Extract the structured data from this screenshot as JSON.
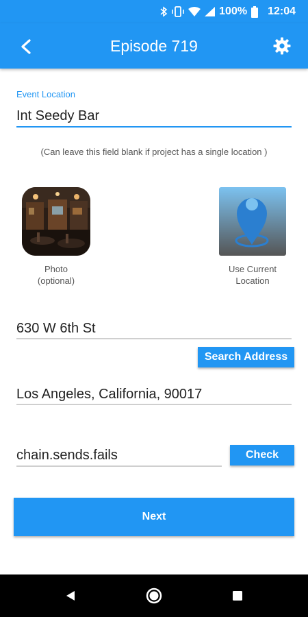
{
  "status_bar": {
    "battery_percent": "100%",
    "time": "12:04"
  },
  "app_bar": {
    "title": "Episode 719"
  },
  "event_location": {
    "label": "Event Location",
    "value": "Int Seedy Bar",
    "hint": "(Can leave this field blank if project has a single location )"
  },
  "photo": {
    "caption_line1": "Photo",
    "caption_line2": "(optional)"
  },
  "use_location": {
    "caption_line1": "Use Current",
    "caption_line2": "Location"
  },
  "address": {
    "street": "630 W 6th St",
    "search_button": "Search Address",
    "city": "Los Angeles, California, 90017"
  },
  "words": {
    "value": "chain.sends.fails",
    "check_button": "Check"
  },
  "next_button": "Next",
  "colors": {
    "primary": "#2196f3"
  }
}
